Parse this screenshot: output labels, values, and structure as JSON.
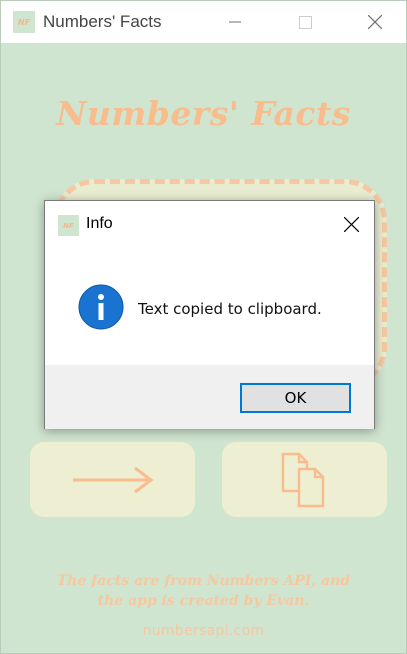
{
  "window": {
    "title": "Numbers' Facts",
    "icon_label": "NF"
  },
  "main": {
    "heading": "Numbers' Facts",
    "next_button_icon": "arrow-right-icon",
    "copy_button_icon": "copy-icon",
    "credit_line1": "The facts are from Numbers API, and",
    "credit_line2": "the app is created by Evan.",
    "site": "numbersapi.com"
  },
  "dialog": {
    "title": "Info",
    "icon_label": "NF",
    "message": "Text copied to clipboard.",
    "ok_label": "OK",
    "status_icon": "info-icon"
  },
  "colors": {
    "background": "#cfe5d0",
    "accent": "#f9bc8d",
    "button_fill": "#eeeed2",
    "dialog_focus": "#0078d7",
    "info_blue": "#1a73d1"
  }
}
